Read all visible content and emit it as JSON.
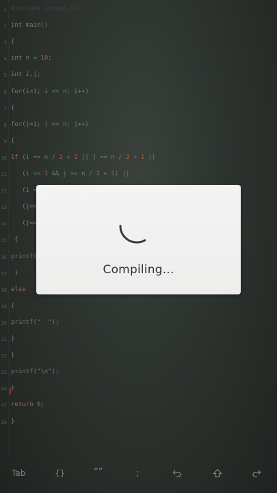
{
  "editor": {
    "lines": [
      {
        "num": "1",
        "text": "#include <stdio.h>",
        "dim": true
      },
      {
        "num": "2",
        "text": "int main()"
      },
      {
        "num": "3",
        "text": "{"
      },
      {
        "num": "4",
        "text": "int n = 10;"
      },
      {
        "num": "5",
        "text": "int i,j;"
      },
      {
        "num": "6",
        "text": "for(i=1; i <= n; i++)"
      },
      {
        "num": "7",
        "text": "{"
      },
      {
        "num": "8",
        "text": "for(j=1; j <= n; j++)"
      },
      {
        "num": "9",
        "text": "{"
      },
      {
        "num": "10",
        "text": "if (i == n / 2 + 1 || j == n / 2 + 1 ||"
      },
      {
        "num": "11",
        "text": "   (i == 1 && j >= n / 2 + 1) ||"
      },
      {
        "num": "12",
        "text": "   (i = "
      },
      {
        "num": "13",
        "text": "   (j=="
      },
      {
        "num": "14",
        "text": "   (j=="
      },
      {
        "num": "15",
        "text": " {"
      },
      {
        "num": "16",
        "text": "printf("
      },
      {
        "num": "17",
        "text": " }"
      },
      {
        "num": "18",
        "text": "else"
      },
      {
        "num": "19",
        "text": "{"
      },
      {
        "num": "20",
        "text": "printf(\"  \");"
      },
      {
        "num": "21",
        "text": "}"
      },
      {
        "num": "22",
        "text": "}"
      },
      {
        "num": "23",
        "text": "printf(\"\\n\");"
      },
      {
        "num": "24",
        "text": "}"
      },
      {
        "num": "47",
        "text": "return 0;"
      },
      {
        "num": "26",
        "text": "}"
      }
    ]
  },
  "dialog": {
    "status_text": "Compiling..."
  },
  "toolbar": {
    "tab_label": "Tab",
    "braces_label": "{}",
    "quotes_label": "“”",
    "semicolon_label": ";",
    "undo_icon": "undo-icon",
    "up_icon": "arrow-up-icon",
    "redo_icon": "redo-icon"
  },
  "colors": {
    "background": "#2d332f",
    "dialog_bg": "#f1f1f0",
    "keyword": "#9c6a62",
    "number": "#a4624f"
  }
}
